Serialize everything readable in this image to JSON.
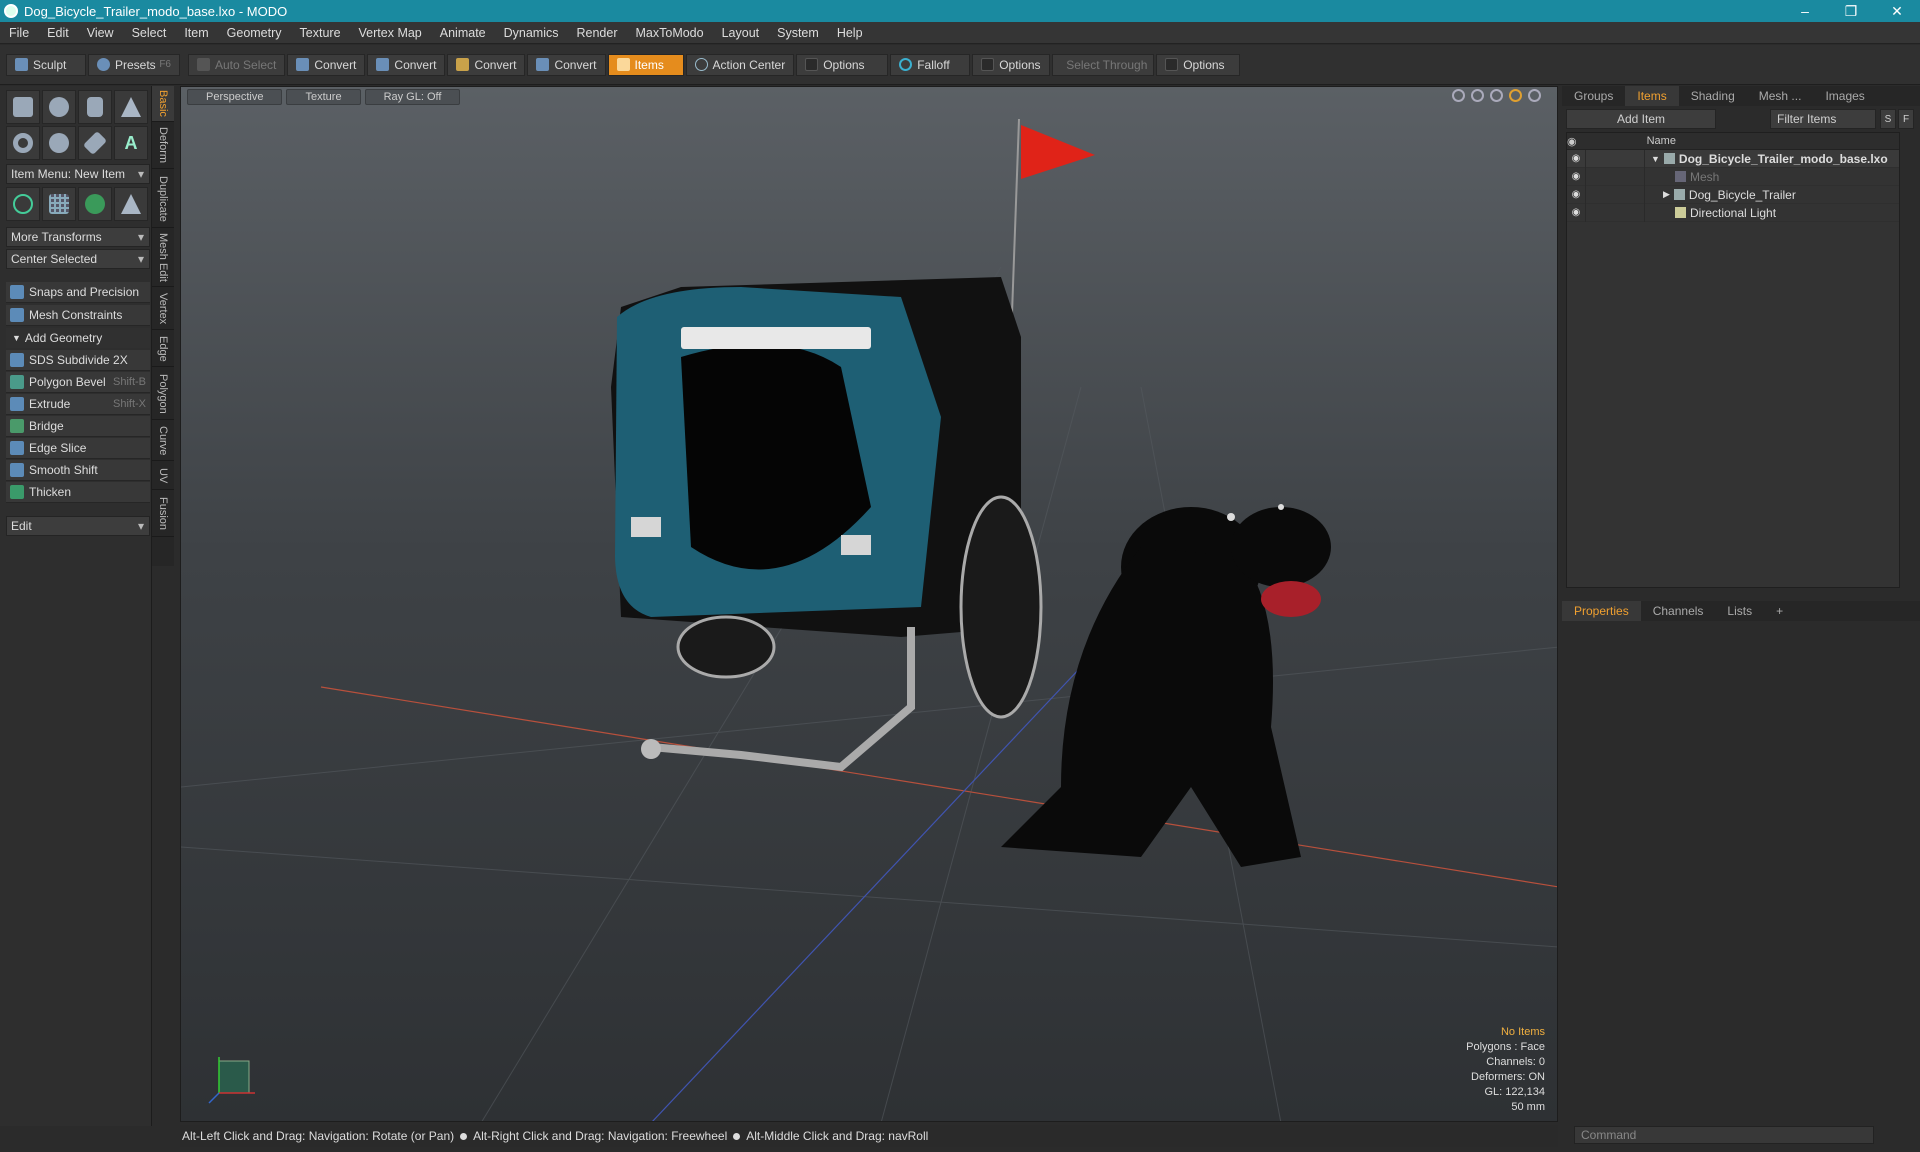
{
  "window": {
    "title": "Dog_Bicycle_Trailer_modo_base.lxo - MODO"
  },
  "menu": [
    "File",
    "Edit",
    "View",
    "Select",
    "Item",
    "Geometry",
    "Texture",
    "Vertex Map",
    "Animate",
    "Dynamics",
    "Render",
    "MaxToModo",
    "Layout",
    "System",
    "Help"
  ],
  "toolbar": {
    "sculpt": "Sculpt",
    "presets": "Presets",
    "presets_key": "F6",
    "auto_select": "Auto Select",
    "convert1": "Convert",
    "convert2": "Convert",
    "convert3": "Convert",
    "convert4": "Convert",
    "items": "Items",
    "action_center": "Action Center",
    "options1": "Options",
    "falloff": "Falloff",
    "options2": "Options",
    "select_through": "Select Through",
    "options3": "Options"
  },
  "left": {
    "item_menu": "Item Menu: New Item",
    "more_transforms": "More Transforms",
    "center_selected": "Center Selected",
    "snaps": "Snaps and Precision",
    "mesh_constraints": "Mesh Constraints",
    "add_geometry": "Add Geometry",
    "tools": [
      {
        "label": "SDS Subdivide 2X",
        "shortcut": ""
      },
      {
        "label": "Polygon Bevel",
        "shortcut": "Shift-B"
      },
      {
        "label": "Extrude",
        "shortcut": "Shift-X"
      },
      {
        "label": "Bridge",
        "shortcut": ""
      },
      {
        "label": "Edge Slice",
        "shortcut": ""
      },
      {
        "label": "Smooth Shift",
        "shortcut": ""
      },
      {
        "label": "Thicken",
        "shortcut": ""
      }
    ],
    "edit": "Edit"
  },
  "vtabs": [
    "Basic",
    "Deform",
    "Duplicate",
    "Mesh Edit",
    "Vertex",
    "Edge",
    "Polygon",
    "Curve",
    "UV",
    "Fusion"
  ],
  "viewport": {
    "perspective": "Perspective",
    "texture": "Texture",
    "raygl": "Ray GL: Off",
    "stats": {
      "no_items": "No Items",
      "polygons": "Polygons : Face",
      "channels": "Channels: 0",
      "deformers": "Deformers: ON",
      "gl": "GL: 122,134",
      "focal": "50 mm"
    }
  },
  "status": {
    "hint1": "Alt-Left Click and Drag: Navigation: Rotate (or Pan)",
    "hint2": "Alt-Right Click and Drag: Navigation: Freewheel",
    "hint3": "Alt-Middle Click and Drag: navRoll"
  },
  "right": {
    "tabs": [
      "Groups",
      "Items",
      "Shading",
      "Mesh ...",
      "Images"
    ],
    "add_item": "Add Item",
    "filter": "Filter Items",
    "s": "S",
    "f": "F",
    "col_name": "Name",
    "tree": [
      {
        "label": "Dog_Bicycle_Trailer_modo_base.lxo"
      },
      {
        "label": "Mesh"
      },
      {
        "label": "Dog_Bicycle_Trailer"
      },
      {
        "label": "Directional Light"
      }
    ],
    "ptabs": [
      "Properties",
      "Channels",
      "Lists"
    ],
    "command": "Command"
  }
}
